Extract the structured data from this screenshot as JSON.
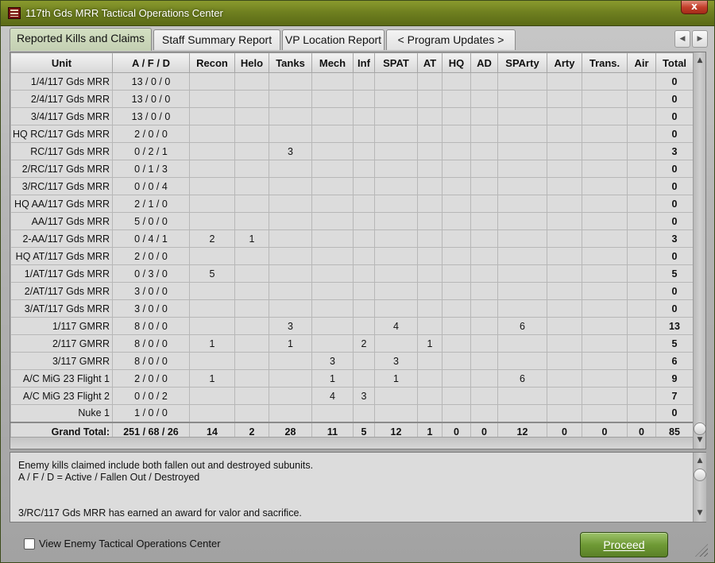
{
  "window": {
    "title": "117th Gds MRR Tactical Operations Center",
    "close_label": "x",
    "accent": "#6f8020"
  },
  "tabs": [
    {
      "label": "Reported Kills and Claims",
      "active": true
    },
    {
      "label": "Staff Summary Report",
      "active": false
    },
    {
      "label": "VP Location Report",
      "active": false
    },
    {
      "label": "< Program Updates >",
      "active": false
    }
  ],
  "tab_scroll": {
    "left_icon": "scroll-left-icon",
    "right_icon": "scroll-right-icon"
  },
  "table": {
    "columns": [
      "Unit",
      "A / F / D",
      "Recon",
      "Helo",
      "Tanks",
      "Mech",
      "Inf",
      "SPAT",
      "AT",
      "HQ",
      "AD",
      "SPArty",
      "Arty",
      "Trans.",
      "Air",
      "Total"
    ],
    "rows": [
      [
        "1/4/117 Gds MRR",
        "13 / 0 / 0",
        "",
        "",
        "",
        "",
        "",
        "",
        "",
        "",
        "",
        "",
        "",
        "",
        "",
        "0"
      ],
      [
        "2/4/117 Gds MRR",
        "13 / 0 / 0",
        "",
        "",
        "",
        "",
        "",
        "",
        "",
        "",
        "",
        "",
        "",
        "",
        "",
        "0"
      ],
      [
        "3/4/117 Gds MRR",
        "13 / 0 / 0",
        "",
        "",
        "",
        "",
        "",
        "",
        "",
        "",
        "",
        "",
        "",
        "",
        "",
        "0"
      ],
      [
        "HQ RC/117 Gds MRR",
        "2 / 0 / 0",
        "",
        "",
        "",
        "",
        "",
        "",
        "",
        "",
        "",
        "",
        "",
        "",
        "",
        "0"
      ],
      [
        "RC/117 Gds MRR",
        "0 / 2 / 1",
        "",
        "",
        "3",
        "",
        "",
        "",
        "",
        "",
        "",
        "",
        "",
        "",
        "",
        "3"
      ],
      [
        "2/RC/117 Gds MRR",
        "0 / 1 / 3",
        "",
        "",
        "",
        "",
        "",
        "",
        "",
        "",
        "",
        "",
        "",
        "",
        "",
        "0"
      ],
      [
        "3/RC/117 Gds MRR",
        "0 / 0 / 4",
        "",
        "",
        "",
        "",
        "",
        "",
        "",
        "",
        "",
        "",
        "",
        "",
        "",
        "0"
      ],
      [
        "HQ AA/117 Gds MRR",
        "2 / 1 / 0",
        "",
        "",
        "",
        "",
        "",
        "",
        "",
        "",
        "",
        "",
        "",
        "",
        "",
        "0"
      ],
      [
        "AA/117 Gds MRR",
        "5 / 0 / 0",
        "",
        "",
        "",
        "",
        "",
        "",
        "",
        "",
        "",
        "",
        "",
        "",
        "",
        "0"
      ],
      [
        "2-AA/117 Gds MRR",
        "0 / 4 / 1",
        "2",
        "1",
        "",
        "",
        "",
        "",
        "",
        "",
        "",
        "",
        "",
        "",
        "",
        "3"
      ],
      [
        "HQ AT/117 Gds MRR",
        "2 / 0 / 0",
        "",
        "",
        "",
        "",
        "",
        "",
        "",
        "",
        "",
        "",
        "",
        "",
        "",
        "0"
      ],
      [
        "1/AT/117 Gds MRR",
        "0 / 3 / 0",
        "5",
        "",
        "",
        "",
        "",
        "",
        "",
        "",
        "",
        "",
        "",
        "",
        "",
        "5"
      ],
      [
        "2/AT/117 Gds MRR",
        "3 / 0 / 0",
        "",
        "",
        "",
        "",
        "",
        "",
        "",
        "",
        "",
        "",
        "",
        "",
        "",
        "0"
      ],
      [
        "3/AT/117 Gds MRR",
        "3 / 0 / 0",
        "",
        "",
        "",
        "",
        "",
        "",
        "",
        "",
        "",
        "",
        "",
        "",
        "",
        "0"
      ],
      [
        "1/117 GMRR",
        "8 / 0 / 0",
        "",
        "",
        "3",
        "",
        "",
        "4",
        "",
        "",
        "",
        "6",
        "",
        "",
        "",
        "13"
      ],
      [
        "2/117 GMRR",
        "8 / 0 / 0",
        "1",
        "",
        "1",
        "",
        "2",
        "",
        "1",
        "",
        "",
        "",
        "",
        "",
        "",
        "5"
      ],
      [
        "3/117 GMRR",
        "8 / 0 / 0",
        "",
        "",
        "",
        "3",
        "",
        "3",
        "",
        "",
        "",
        "",
        "",
        "",
        "",
        "6"
      ],
      [
        "A/C MiG 23 Flight 1",
        "2 / 0 / 0",
        "1",
        "",
        "",
        "1",
        "",
        "1",
        "",
        "",
        "",
        "6",
        "",
        "",
        "",
        "9"
      ],
      [
        "A/C MiG 23 Flight 2",
        "0 / 0 / 2",
        "",
        "",
        "",
        "4",
        "3",
        "",
        "",
        "",
        "",
        "",
        "",
        "",
        "",
        "7"
      ],
      [
        "Nuke 1",
        "1 / 0 / 0",
        "",
        "",
        "",
        "",
        "",
        "",
        "",
        "",
        "",
        "",
        "",
        "",
        "",
        "0"
      ]
    ],
    "grand_total": [
      "Grand Total:",
      "251 / 68 / 26",
      "14",
      "2",
      "28",
      "11",
      "5",
      "12",
      "1",
      "0",
      "0",
      "12",
      "0",
      "0",
      "0",
      "85"
    ]
  },
  "notes": [
    "Enemy kills claimed include both fallen out and destroyed subunits.",
    "A / F / D = Active / Fallen Out / Destroyed",
    "",
    "",
    "3/RC/117 Gds MRR has earned an award for valor and sacrifice."
  ],
  "footer": {
    "checkbox_label": "View Enemy Tactical Operations Center",
    "checkbox_checked": false,
    "proceed_label": "Proceed"
  }
}
